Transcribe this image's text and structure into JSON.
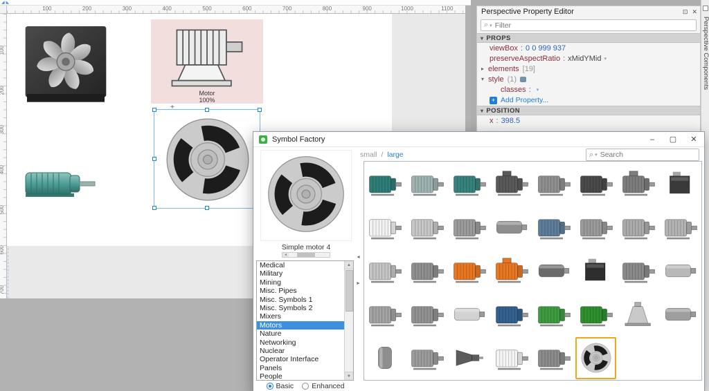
{
  "icons": {
    "close": "✕",
    "minimize": "–",
    "maximize": "▢",
    "float": "⊡",
    "search": "⌕",
    "dropdown": "▾",
    "expand": "▸",
    "collapse": "▾",
    "up": "▲",
    "down": "▼",
    "left": "◄",
    "right": "►",
    "plus": "+"
  },
  "canvas": {
    "ruler_h": [
      "100",
      "200",
      "300",
      "400",
      "500",
      "600",
      "700",
      "800",
      "900",
      "1000",
      "1100"
    ],
    "ruler_v": [
      "100",
      "200",
      "300",
      "400",
      "500",
      "600",
      "700"
    ],
    "motor_label": "Motor",
    "motor_percent": "100%",
    "plus_marker": "+"
  },
  "property_editor": {
    "title": "Perspective Property Editor",
    "filter_placeholder": "Filter",
    "props_header": "PROPS",
    "position_header": "POSITION",
    "rows": [
      {
        "name": "viewBox",
        "sep": ":",
        "value": "0 0 999 937"
      },
      {
        "name": "preserveAspectRatio",
        "sep": ":",
        "value": "xMidYMid"
      },
      {
        "name": "elements",
        "value": "[19]"
      },
      {
        "name": "style",
        "value": "(1)"
      },
      {
        "name": "classes",
        "sep": ":"
      }
    ],
    "add_property": "Add Property...",
    "position_rows": [
      {
        "name": "x",
        "sep": ":",
        "value": "398.5"
      }
    ]
  },
  "side_tab": {
    "label": "Perspective Components"
  },
  "symbol_factory": {
    "title": "Symbol Factory",
    "size_options": [
      {
        "label": "small",
        "active": false
      },
      {
        "label": "large",
        "active": true
      }
    ],
    "size_separator": "/",
    "search_placeholder": "Search",
    "preview_caption": "Simple motor 4",
    "categories": [
      "Medical",
      "Military",
      "Mining",
      "Misc. Pipes",
      "Misc. Symbols 1",
      "Misc. Symbols 2",
      "Mixers",
      "Motors",
      "Nature",
      "Networking",
      "Nuclear",
      "Operator Interface",
      "Panels",
      "People"
    ],
    "selected_category": "Motors",
    "radios": [
      {
        "label": "Basic",
        "selected": true
      },
      {
        "label": "Enhanced",
        "selected": false
      }
    ],
    "grid": [
      {
        "shape": "motor",
        "color": "#2e7d78"
      },
      {
        "shape": "motor",
        "color": "#9fb3b1"
      },
      {
        "shape": "motor",
        "color": "#37837d"
      },
      {
        "shape": "motorbox",
        "color": "#5a5a5a"
      },
      {
        "shape": "motor",
        "color": "#8f8f8f"
      },
      {
        "shape": "motor",
        "color": "#4a4a4a"
      },
      {
        "shape": "motorbox",
        "color": "#7d7d7d"
      },
      {
        "shape": "box",
        "color": "#3a3a3a"
      },
      {
        "shape": "motor",
        "color": "#f2f2f2"
      },
      {
        "shape": "motor",
        "color": "#c7c7c7"
      },
      {
        "shape": "motor",
        "color": "#9b9b9b"
      },
      {
        "shape": "cyl",
        "color": "#8d8d8d"
      },
      {
        "shape": "motor",
        "color": "#5d7d9a"
      },
      {
        "shape": "motor",
        "color": "#9a9a9a"
      },
      {
        "shape": "motor",
        "color": "#ababab"
      },
      {
        "shape": "motor",
        "color": "#b3b3b3"
      },
      {
        "shape": "motor",
        "color": "#c4c4c4"
      },
      {
        "shape": "motor",
        "color": "#8f8f8f"
      },
      {
        "shape": "motor",
        "color": "#e87722"
      },
      {
        "shape": "motorbox",
        "color": "#e87722"
      },
      {
        "shape": "cyl",
        "color": "#6a6a6a"
      },
      {
        "shape": "box",
        "color": "#2e2e2e"
      },
      {
        "shape": "motor",
        "color": "#8a8a8a"
      },
      {
        "shape": "cyl",
        "color": "#b8b8b8"
      },
      {
        "shape": "motor",
        "color": "#a3a3a3"
      },
      {
        "shape": "motor",
        "color": "#929292"
      },
      {
        "shape": "cyl",
        "color": "#d2d2d2"
      },
      {
        "shape": "motor",
        "color": "#33618f"
      },
      {
        "shape": "motor",
        "color": "#3f9b3f"
      },
      {
        "shape": "motor",
        "color": "#2f8f2f"
      },
      {
        "shape": "bell",
        "color": "#c9c9c9"
      },
      {
        "shape": "cyl",
        "color": "#9e9e9e"
      },
      {
        "shape": "vcyl",
        "color": "#8f8f8f"
      },
      {
        "shape": "motor",
        "color": "#9c9c9c"
      },
      {
        "shape": "cone",
        "color": "#5c5c5c"
      },
      {
        "shape": "motor",
        "color": "#f4f4f4"
      },
      {
        "shape": "motor",
        "color": "#8c8c8c"
      },
      {
        "shape": "round",
        "color": "#c9c9c9",
        "selected": true
      }
    ]
  }
}
